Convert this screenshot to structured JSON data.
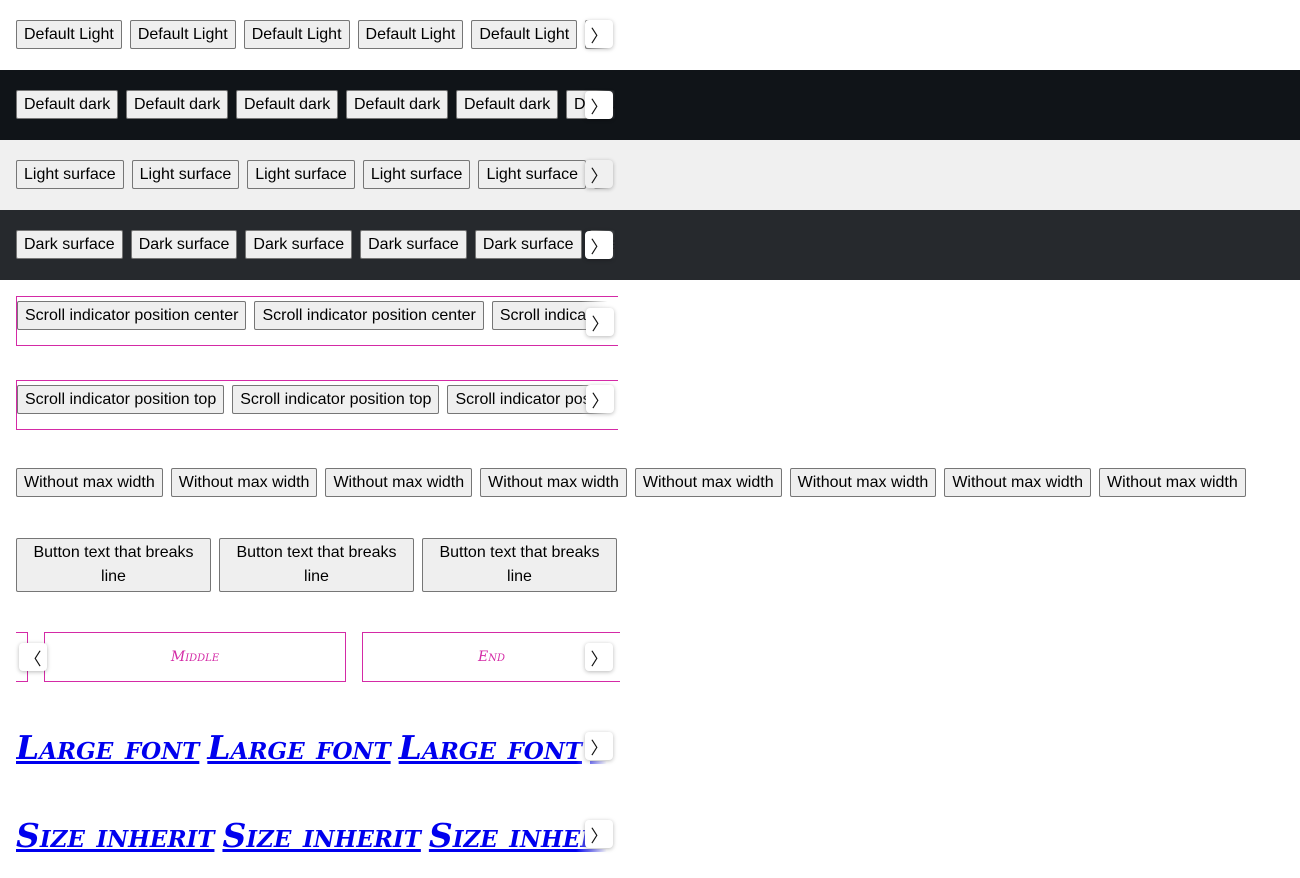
{
  "rows": {
    "default_light": {
      "label": "Default Light",
      "background": "#ffffff"
    },
    "default_dark": {
      "label": "Default dark",
      "background": "#101418"
    },
    "light_surface": {
      "label": "Light surface",
      "background": "#f0f0f0"
    },
    "dark_surface": {
      "label": "Dark surface",
      "background": "#26292d"
    },
    "indicator_center": {
      "label": "Scroll indicator position center"
    },
    "indicator_top": {
      "label": "Scroll indicator position top"
    },
    "no_max_width": {
      "label": "Without max width"
    },
    "line_break": {
      "label": "Button text that breaks line"
    },
    "positions": {
      "middle": "Middle",
      "end": "End"
    },
    "large_font": {
      "label": "Large font"
    },
    "size_inherit": {
      "label": "Size inherit"
    }
  },
  "icons": {
    "next": "chevron-right-icon",
    "previous": "chevron-left-icon"
  },
  "glyphs": {
    "next": "〉",
    "previous": "〈"
  },
  "colors": {
    "accent_border": "#d42aa6",
    "link": "#0000ee"
  }
}
